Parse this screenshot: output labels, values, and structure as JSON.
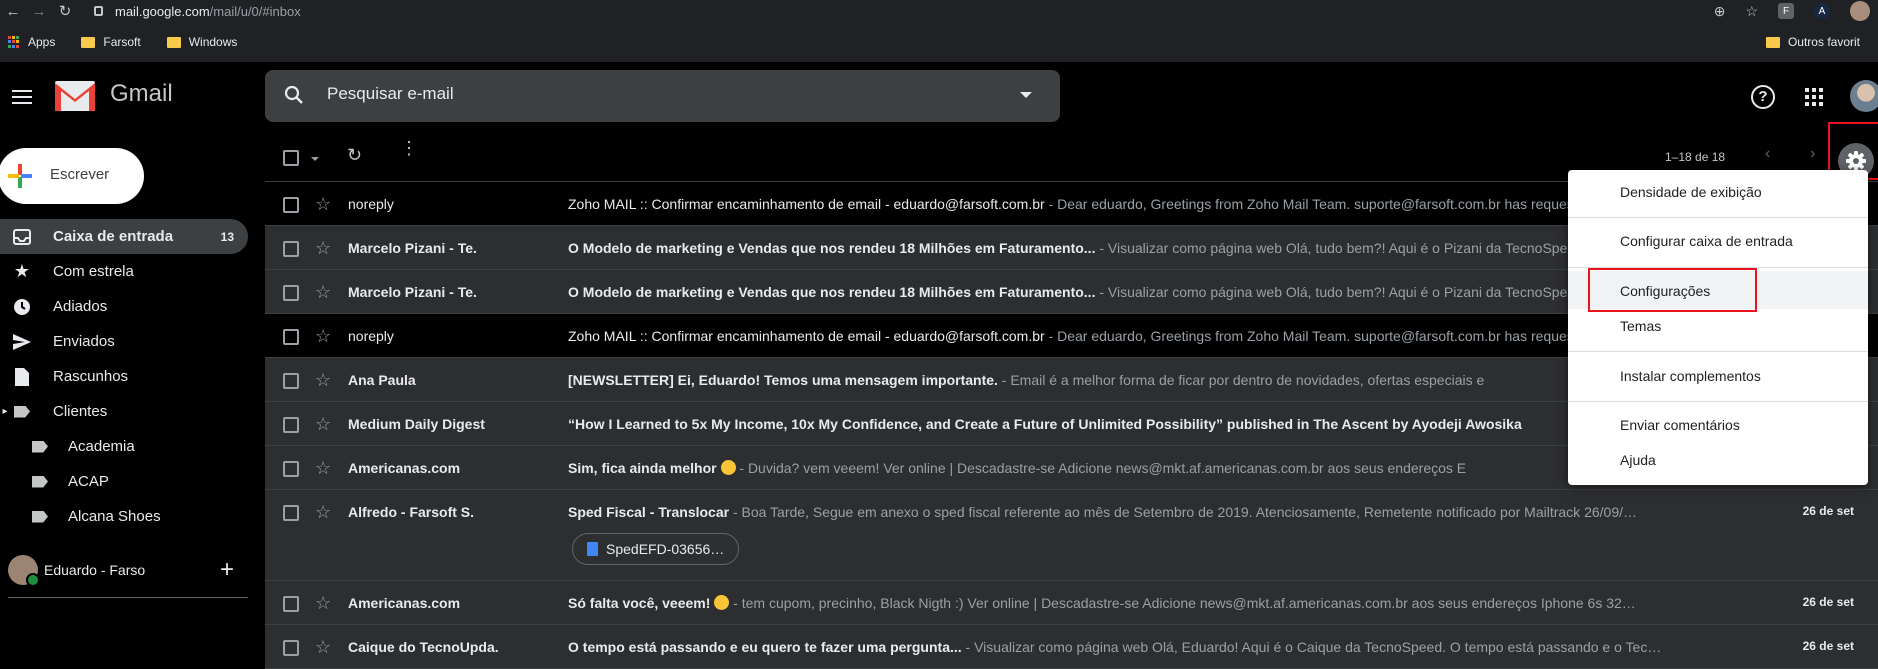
{
  "browser": {
    "url_host": "mail.google.com",
    "url_path": "/mail/u/0/#inbox",
    "extension_f": "F",
    "extension_a": "A",
    "bookmarks": [
      "Apps",
      "Farsoft",
      "Windows"
    ],
    "bookmarks_right": "Outros favorit"
  },
  "header": {
    "app_title": "Gmail",
    "search_placeholder": "Pesquisar e-mail"
  },
  "sidebar": {
    "compose_label": "Escrever",
    "items": [
      {
        "label": "Caixa de entrada",
        "count": "13",
        "icon": "inbox-icon"
      },
      {
        "label": "Com estrela",
        "icon": "star-icon"
      },
      {
        "label": "Adiados",
        "icon": "clock-icon"
      },
      {
        "label": "Enviados",
        "icon": "send-icon"
      },
      {
        "label": "Rascunhos",
        "icon": "draft-icon"
      },
      {
        "label": "Clientes",
        "icon": "label-icon"
      },
      {
        "label": "Academia",
        "icon": "label-icon"
      },
      {
        "label": "ACAP",
        "icon": "label-icon"
      },
      {
        "label": "Alcana Shoes",
        "icon": "label-icon"
      }
    ],
    "hangouts_user": "Eduardo - Farso"
  },
  "toolbar": {
    "pager": "1–18 de 18"
  },
  "emails": [
    {
      "from": "noreply",
      "subject": "Zoho MAIL :: Confirmar encaminhamento de email - eduardo@farsoft.com.br",
      "snippet": " - Dear eduardo, Greetings from Zoho Mail Team. suporte@farsoft.com.br has requested to forward the emails",
      "date": ""
    },
    {
      "from": "Marcelo Pizani - Te.",
      "subject": "O Modelo de marketing e Vendas que nos rendeu 18 Milhões em Faturamento...",
      "snippet": " - Visualizar como página web Olá, tudo bem?! Aqui é o Pizani da TecnoSpeed",
      "date": ""
    },
    {
      "from": "Marcelo Pizani - Te.",
      "subject": "O Modelo de marketing e Vendas que nos rendeu 18 Milhões em Faturamento...",
      "snippet": " - Visualizar como página web Olá, tudo bem?! Aqui é o Pizani da TecnoSpeed",
      "date": ""
    },
    {
      "from": "noreply",
      "subject": "Zoho MAIL :: Confirmar encaminhamento de email - eduardo@farsoft.com.br",
      "snippet": " - Dear eduardo, Greetings from Zoho Mail Team. suporte@farsoft.com.br has requested to forward the emails",
      "date": ""
    },
    {
      "from": "Ana Paula",
      "subject": "[NEWSLETTER] Ei, Eduardo! Temos uma mensagem importante.",
      "snippet": " - Email é a melhor forma de ficar por dentro de novidades, ofertas especiais e",
      "date": ""
    },
    {
      "from": "Medium Daily Digest",
      "subject": "“How I Learned to 5x My Income, 10x My Confidence, and Create a Future of Unlimited Possibility” published in The Ascent by Ayodeji Awosika",
      "snippet": "",
      "date": ""
    },
    {
      "from": "Americanas.com",
      "subject": "Sim, fica ainda melhor",
      "snippet": " - Duvida? vem veeem! Ver online | Descadastre-se Adicione news@mkt.af.americanas.com.br aos seus endereços E",
      "date": ""
    },
    {
      "from": "Alfredo - Farsoft S.",
      "subject": "Sped Fiscal - Translocar",
      "snippet": " - Boa Tarde, Segue em anexo o sped fiscal referente ao mês de Setembro de 2019. Atenciosamente, Remetente notificado por Mailtrack 26/09/…",
      "date": "26 de set",
      "attachment": "SpedEFD-03656…"
    },
    {
      "from": "Americanas.com",
      "subject": "Só falta você, veeem!",
      "snippet": " - tem cupom, precinho, Black Nigth :) Ver online | Descadastre-se Adicione news@mkt.af.americanas.com.br aos seus endereços Iphone 6s 32…",
      "date": "26 de set"
    },
    {
      "from": "Caique do TecnoUpda.",
      "subject": "O tempo está passando e eu quero te fazer uma pergunta...",
      "snippet": " - Visualizar como página web Olá, Eduardo! Aqui é o Caique da TecnoSpeed. O tempo está passando e o Tec…",
      "date": "26 de set"
    }
  ],
  "settings_menu": {
    "items": [
      "Densidade de exibição",
      "Configurar caixa de entrada",
      "Configurações",
      "Temas",
      "Instalar complementos",
      "Enviar comentários",
      "Ajuda"
    ],
    "highlight_color": "#e8141e"
  }
}
